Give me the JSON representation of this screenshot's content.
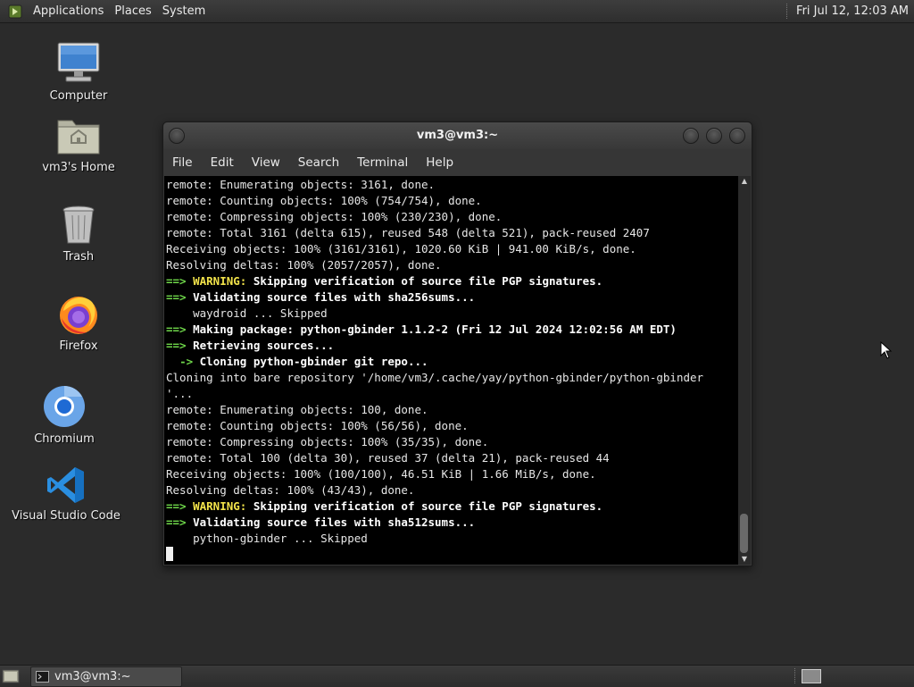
{
  "top_panel": {
    "menus": [
      "Applications",
      "Places",
      "System"
    ],
    "clock": "Fri Jul 12, 12:03 AM"
  },
  "desktop_icons": [
    {
      "label": "Computer",
      "icon": "computer-icon"
    },
    {
      "label": "vm3's Home",
      "icon": "home-folder-icon"
    },
    {
      "label": "Trash",
      "icon": "trash-icon"
    },
    {
      "label": "Firefox",
      "icon": "firefox-icon"
    },
    {
      "label": "Chromium",
      "icon": "chromium-icon"
    },
    {
      "label": "Visual Studio Code",
      "icon": "vscode-icon"
    }
  ],
  "terminal": {
    "title": "vm3@vm3:~",
    "menus": [
      "File",
      "Edit",
      "View",
      "Search",
      "Terminal",
      "Help"
    ],
    "lines": [
      "remote: Enumerating objects: 3161, done.",
      "remote: Counting objects: 100% (754/754), done.",
      "remote: Compressing objects: 100% (230/230), done.",
      "remote: Total 3161 (delta 615), reused 548 (delta 521), pack-reused 2407",
      "Receiving objects: 100% (3161/3161), 1020.60 KiB | 941.00 KiB/s, done.",
      "Resolving deltas: 100% (2057/2057), done.",
      "==> WARNING: Skipping verification of source file PGP signatures.",
      "==> Validating source files with sha256sums...",
      "    waydroid ... Skipped",
      "==> Making package: python-gbinder 1.1.2-2 (Fri 12 Jul 2024 12:02:56 AM EDT)",
      "==> Retrieving sources...",
      "  -> Cloning python-gbinder git repo...",
      "Cloning into bare repository '/home/vm3/.cache/yay/python-gbinder/python-gbinder",
      "'...",
      "remote: Enumerating objects: 100, done.",
      "remote: Counting objects: 100% (56/56), done.",
      "remote: Compressing objects: 100% (35/35), done.",
      "remote: Total 100 (delta 30), reused 37 (delta 21), pack-reused 44",
      "Receiving objects: 100% (100/100), 46.51 KiB | 1.66 MiB/s, done.",
      "Resolving deltas: 100% (43/43), done.",
      "==> WARNING: Skipping verification of source file PGP signatures.",
      "==> Validating source files with sha512sums...",
      "    python-gbinder ... Skipped"
    ]
  },
  "taskbar": {
    "items": [
      {
        "label": "vm3@vm3:~",
        "icon": "terminal-icon"
      }
    ]
  },
  "colors": {
    "arrow": "#6fd84a",
    "warning": "#f2e34a",
    "desktop": "#2b2b2b"
  }
}
